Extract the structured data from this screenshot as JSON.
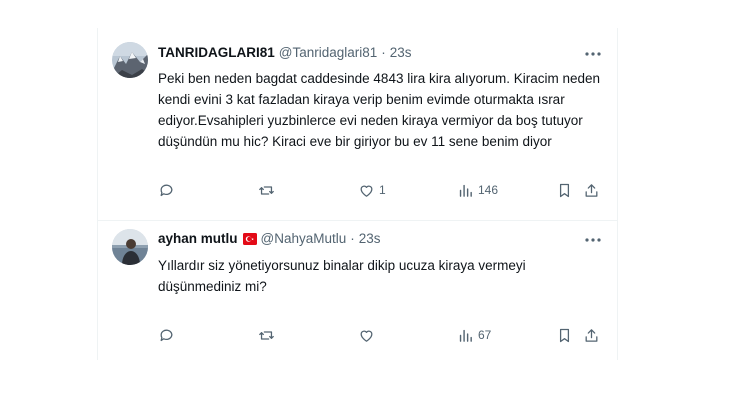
{
  "tweets": [
    {
      "name": "TANRIDAGLARI81",
      "handle": "@Tanridaglari81",
      "separator": "·",
      "time": "23s",
      "text": "Peki ben neden bagdat caddesinde 4843  lira kira alıyorum. Kiracim neden\nkendi evini 3 kat fazladan kiraya verip benim evimde oturmakta ısrar\nediyor.Evsahipleri yuzbinlerce evi neden kiraya vermiyor da boş tutuyor\ndüşündün mu hic? Kiraci eve bir giriyor bu ev 11 sene benim diyor",
      "replies": "",
      "retweets": "",
      "likes": "1",
      "views": "146",
      "avatar_icon": "mountain-landscape-avatar"
    },
    {
      "name": "ayhan mutlu",
      "flag_icon": "turkey-flag-icon",
      "handle": "@NahyaMutlu",
      "separator": "·",
      "time": "23s",
      "text": "Yıllardır siz yönetiyorsunuz binalar dikip ucuza kiraya vermeyi\ndüşünmediniz mi?",
      "replies": "",
      "retweets": "",
      "likes": "",
      "views": "67",
      "avatar_icon": "person-at-sea-avatar"
    }
  ],
  "colors": {
    "text_primary": "#0f1419",
    "text_secondary": "#536471",
    "divider": "#eff3f4",
    "flag_red": "#e30a17"
  },
  "icons": [
    "more-icon",
    "reply-icon",
    "retweet-icon",
    "like-icon",
    "views-icon",
    "bookmark-icon",
    "share-icon"
  ]
}
